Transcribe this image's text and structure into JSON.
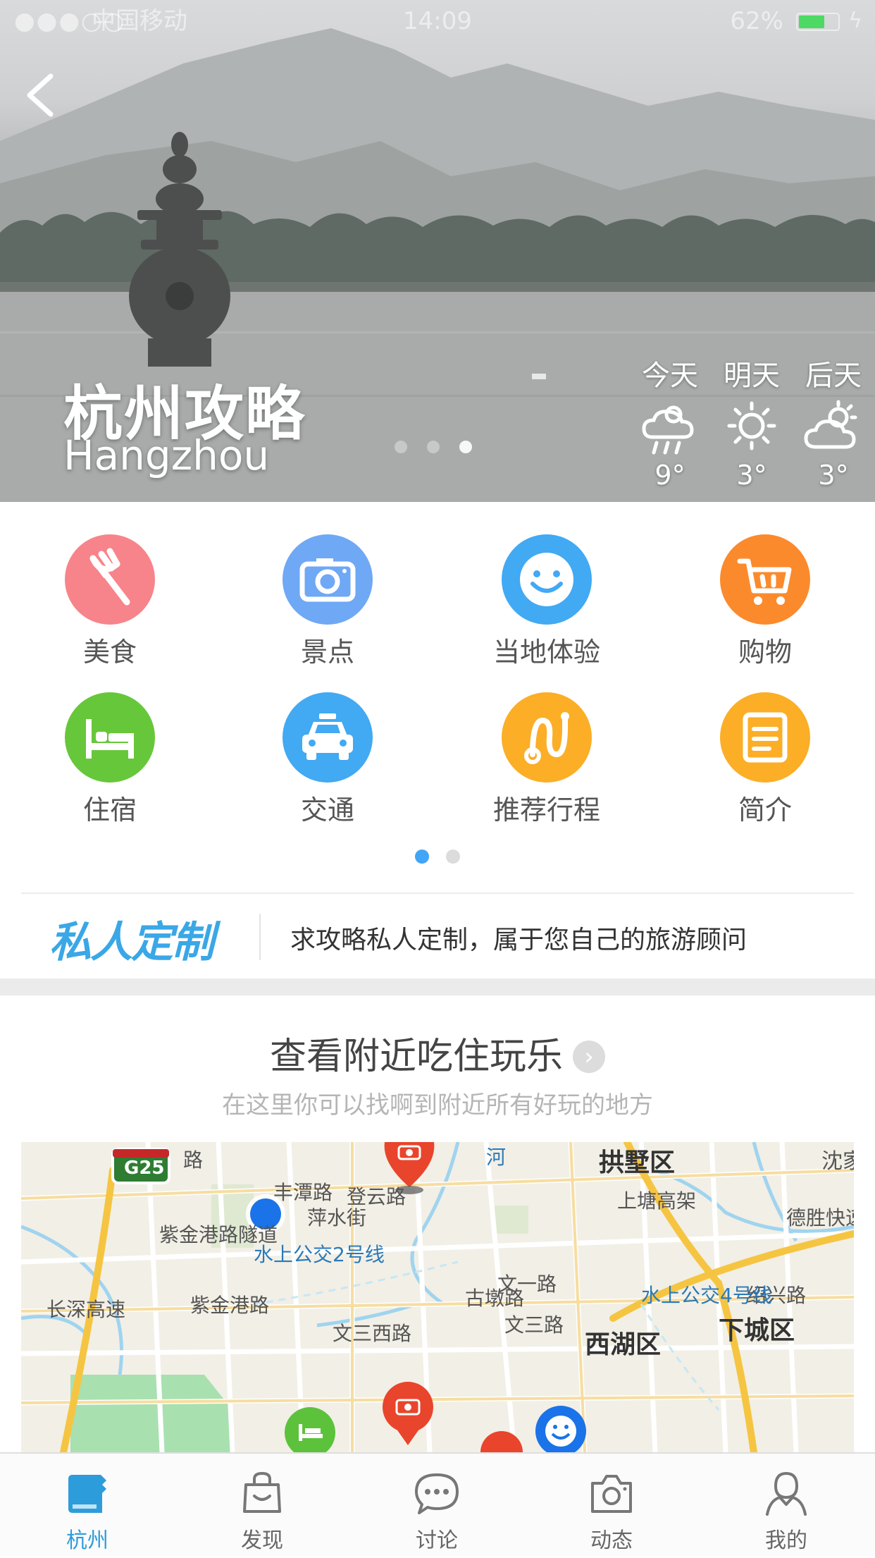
{
  "status_bar": {
    "signal": "●●●○○",
    "carrier": "中国移动",
    "time": "14:09",
    "battery_text": "62%",
    "battery_level_percent": 62
  },
  "hero": {
    "title": "杭州攻略",
    "subtitle": "Hangzhou",
    "slide_count": 3,
    "active_slide": 3,
    "weather": [
      {
        "day": "今天",
        "icon": "rain-cloud-icon",
        "temp": "9°"
      },
      {
        "day": "明天",
        "icon": "sun-icon",
        "temp": "3°"
      },
      {
        "day": "后天",
        "icon": "cloudy-sun-icon",
        "temp": "3°"
      }
    ]
  },
  "categories": [
    {
      "label": "美食",
      "icon": "fork-icon",
      "color": "#f7848a"
    },
    {
      "label": "景点",
      "icon": "camera-icon",
      "color": "#6fa8f5"
    },
    {
      "label": "当地体验",
      "icon": "smile-icon",
      "color": "#42a9f3"
    },
    {
      "label": "购物",
      "icon": "cart-icon",
      "color": "#fb8a2c"
    },
    {
      "label": "住宿",
      "icon": "bed-icon",
      "color": "#67c73a"
    },
    {
      "label": "交通",
      "icon": "taxi-icon",
      "color": "#42a9f3"
    },
    {
      "label": "推荐行程",
      "icon": "route-icon",
      "color": "#fbae26"
    },
    {
      "label": "简介",
      "icon": "document-icon",
      "color": "#fbae26"
    }
  ],
  "category_pages": {
    "count": 2,
    "active": 1
  },
  "custom": {
    "brand": "私人定制",
    "description": "求攻略私人定制，属于您自己的旅游顾问"
  },
  "nearby": {
    "title": "查看附近吃住玩乐",
    "subtitle": "在这里你可以找啊到附近所有好玩的地方"
  },
  "map": {
    "labels": {
      "g25": "G25",
      "gongshu": "拱墅区",
      "shenjia": "沈家",
      "desheng": "德胜快速",
      "shaoxing": "绍兴路",
      "xiacheng": "下城区",
      "xihu": "西湖区",
      "fengtan": "丰潭路",
      "pingshui": "萍水街",
      "dengyun": "登云路",
      "shangtang": "上塘高架",
      "zijingang_tunnel": "紫金港路隧道",
      "zijingang": "紫金港路",
      "waterbus2": "水上公交2号线",
      "waterbus4": "水上公交4号线",
      "wenyi": "文一路",
      "wensan": "文三路",
      "wensan_west": "文三西路",
      "gudun": "古墩路",
      "changshen": "长深高速",
      "lu": "路",
      "hu": "河"
    }
  },
  "colors": {
    "accent": "#2d9cdb",
    "pin_red": "#e8452c",
    "pin_blue": "#1a73e8",
    "pin_green": "#5cc23b"
  },
  "tabs": [
    {
      "label": "杭州",
      "icon": "guidebook-icon",
      "active": true
    },
    {
      "label": "发现",
      "icon": "shopping-bag-icon",
      "active": false
    },
    {
      "label": "讨论",
      "icon": "chat-bubble-icon",
      "active": false
    },
    {
      "label": "动态",
      "icon": "camera-icon",
      "active": false
    },
    {
      "label": "我的",
      "icon": "user-icon",
      "active": false
    }
  ]
}
